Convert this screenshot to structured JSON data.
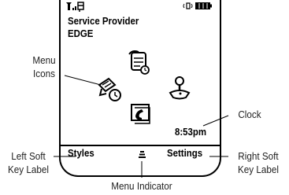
{
  "phone": {
    "status_icons": [
      "signal-icon",
      "message-icon",
      "ringer-icon",
      "battery-icon"
    ],
    "provider": "Service Provider",
    "network": "EDGE",
    "menu_icons": [
      "calendar-icon",
      "settings-icon",
      "games-icon",
      "phone-icon"
    ],
    "clock": "8:53pm",
    "soft_key_left": "Styles",
    "soft_key_right": "Settings",
    "menu_indicator_icon": "menu-indicator-icon"
  },
  "callouts": {
    "menu_icons": "Menu Icons",
    "clock": "Clock",
    "left_soft_key": "Left Soft Key Label",
    "right_soft_key": "Right Soft Key Label",
    "menu_indicator": "Menu Indicator"
  }
}
